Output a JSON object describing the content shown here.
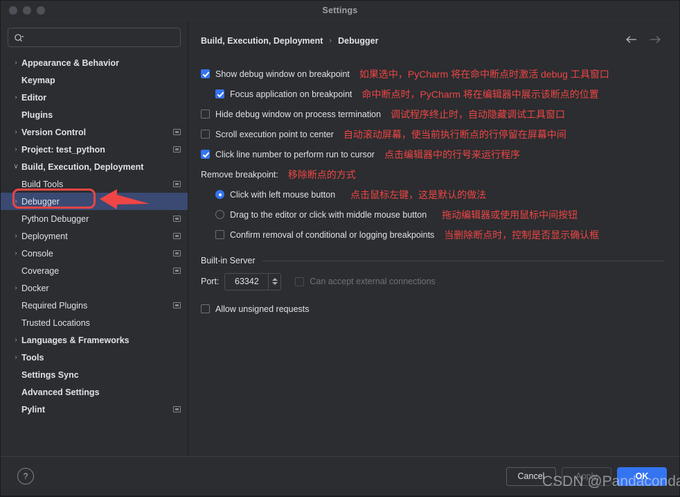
{
  "window": {
    "title": "Settings",
    "traffic_lights": [
      "close-light",
      "minimize-light",
      "zoom-light"
    ]
  },
  "sidebar": {
    "search": {
      "value": "",
      "placeholder": "",
      "icon": "search-icon"
    },
    "items": [
      {
        "label": "Appearance & Behavior",
        "level": 0,
        "twisty": "›",
        "bold": true,
        "badge": false,
        "selected": false
      },
      {
        "label": "Keymap",
        "level": 0,
        "twisty": "",
        "bold": true,
        "badge": false,
        "selected": false
      },
      {
        "label": "Editor",
        "level": 0,
        "twisty": "›",
        "bold": true,
        "badge": false,
        "selected": false
      },
      {
        "label": "Plugins",
        "level": 0,
        "twisty": "",
        "bold": true,
        "badge": false,
        "selected": false
      },
      {
        "label": "Version Control",
        "level": 0,
        "twisty": "›",
        "bold": true,
        "badge": true,
        "selected": false
      },
      {
        "label": "Project: test_python",
        "level": 0,
        "twisty": "›",
        "bold": true,
        "badge": true,
        "selected": false
      },
      {
        "label": "Build, Execution, Deployment",
        "level": 0,
        "twisty": "∨",
        "bold": true,
        "badge": false,
        "selected": false
      },
      {
        "label": "Build Tools",
        "level": 1,
        "twisty": "",
        "bold": false,
        "badge": true,
        "selected": false
      },
      {
        "label": "Debugger",
        "level": 1,
        "twisty": "›",
        "bold": false,
        "badge": false,
        "selected": true
      },
      {
        "label": "Python Debugger",
        "level": 1,
        "twisty": "",
        "bold": false,
        "badge": true,
        "selected": false
      },
      {
        "label": "Deployment",
        "level": 1,
        "twisty": "›",
        "bold": false,
        "badge": true,
        "selected": false
      },
      {
        "label": "Console",
        "level": 1,
        "twisty": "›",
        "bold": false,
        "badge": true,
        "selected": false
      },
      {
        "label": "Coverage",
        "level": 1,
        "twisty": "",
        "bold": false,
        "badge": true,
        "selected": false
      },
      {
        "label": "Docker",
        "level": 1,
        "twisty": "›",
        "bold": false,
        "badge": false,
        "selected": false
      },
      {
        "label": "Required Plugins",
        "level": 1,
        "twisty": "",
        "bold": false,
        "badge": true,
        "selected": false
      },
      {
        "label": "Trusted Locations",
        "level": 1,
        "twisty": "",
        "bold": false,
        "badge": false,
        "selected": false
      },
      {
        "label": "Languages & Frameworks",
        "level": 0,
        "twisty": "›",
        "bold": true,
        "badge": false,
        "selected": false
      },
      {
        "label": "Tools",
        "level": 0,
        "twisty": "›",
        "bold": true,
        "badge": false,
        "selected": false
      },
      {
        "label": "Settings Sync",
        "level": 0,
        "twisty": "",
        "bold": true,
        "badge": false,
        "selected": false
      },
      {
        "label": "Advanced Settings",
        "level": 0,
        "twisty": "",
        "bold": true,
        "badge": false,
        "selected": false
      },
      {
        "label": "Pylint",
        "level": 0,
        "twisty": "",
        "bold": true,
        "badge": true,
        "selected": false
      }
    ]
  },
  "main": {
    "breadcrumb": {
      "root": "Build, Execution, Deployment",
      "separator": "›",
      "leaf": "Debugger"
    },
    "nav": {
      "back": "back-arrow-icon",
      "forward": "forward-arrow-icon"
    },
    "options": [
      {
        "label": "Show debug window on breakpoint",
        "checked": true,
        "indent": 0,
        "note": "如果选中，PyCharm 将在命中断点时激活 debug 工具窗口"
      },
      {
        "label": "Focus application on breakpoint",
        "checked": true,
        "indent": 1,
        "note": "命中断点时，PyCharm 将在编辑器中展示该断点的位置"
      },
      {
        "label": "Hide debug window on process termination",
        "checked": false,
        "indent": 0,
        "note": "调试程序终止时，自动隐藏调试工具窗口"
      },
      {
        "label": "Scroll execution point to center",
        "checked": false,
        "indent": 0,
        "note": "自动滚动屏幕，使当前执行断点的行停留在屏幕中间"
      },
      {
        "label": "Click line number to perform run to cursor",
        "checked": true,
        "indent": 0,
        "note": "点击编辑器中的行号来运行程序"
      }
    ],
    "remove_breakpoint": {
      "label": "Remove breakpoint:",
      "note": "移除断点的方式",
      "radios": [
        {
          "label": "Click with left mouse button",
          "checked": true,
          "note": "点击鼠标左键，这是默认的做法"
        },
        {
          "label": "Drag to the editor or click with middle mouse button",
          "checked": false,
          "note": "拖动编辑器或使用鼠标中间按钮"
        }
      ],
      "confirm": {
        "label": "Confirm removal of conditional or logging breakpoints",
        "checked": false,
        "note": "当删除断点时，控制是否显示确认框"
      }
    },
    "built_in_server": {
      "title": "Built-in Server",
      "port_label": "Port:",
      "port_value": "63342",
      "external_label": "Can accept external connections",
      "external_checked": false,
      "external_disabled": true,
      "unsigned_label": "Allow unsigned requests",
      "unsigned_checked": false
    }
  },
  "footer": {
    "help": "?",
    "cancel": "Cancel",
    "apply": "Apply",
    "ok": "OK"
  },
  "annotations": {
    "watermark": "CSDN @Pandaconda",
    "highlight_color": "#f04545",
    "arrow": "left-pointing-arrow"
  }
}
